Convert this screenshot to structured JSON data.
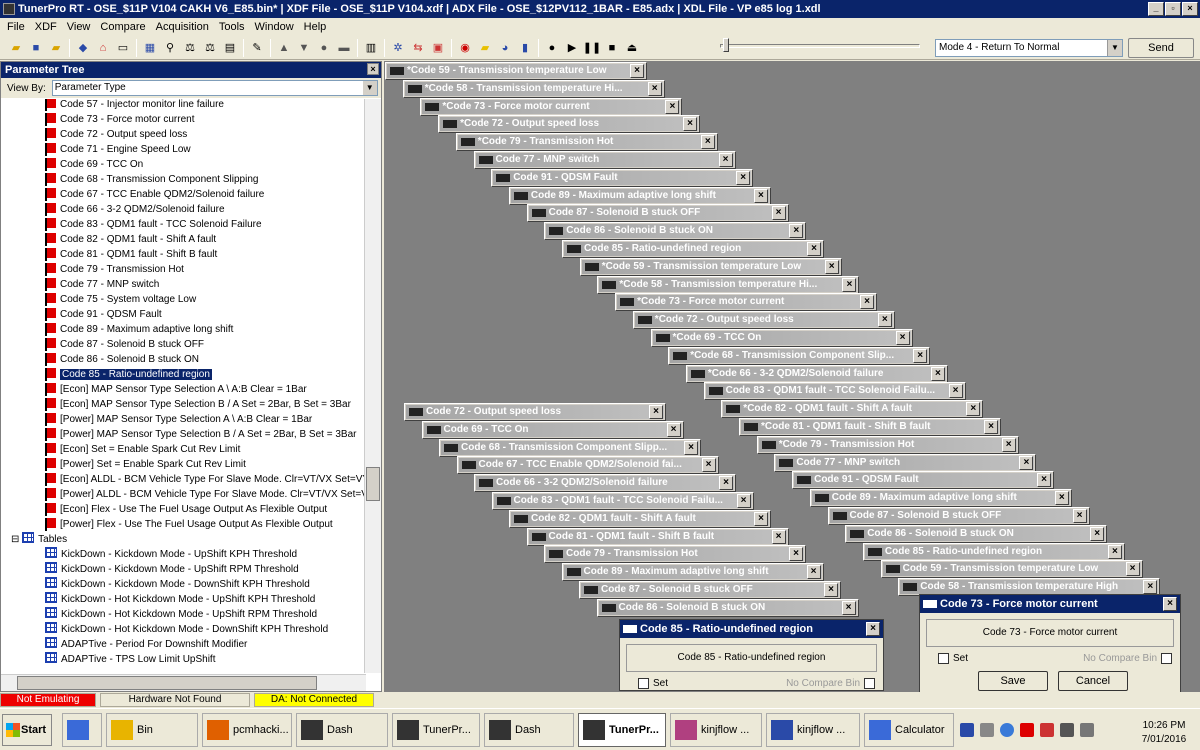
{
  "window": {
    "title": "TunerPro RT - OSE_$11P V104 CAKH V6_E85.bin* | XDF File - OSE_$11P V104.xdf | ADX File - OSE_$12PV112_1BAR - E85.adx | XDL File - VP e85 log 1.xdl"
  },
  "menu": [
    "File",
    "XDF",
    "View",
    "Compare",
    "Acquisition",
    "Tools",
    "Window",
    "Help"
  ],
  "toolbar": {
    "mode": "Mode 4 - Return To Normal",
    "send": "Send"
  },
  "paramtree": {
    "title": "Parameter Tree",
    "viewby_label": "View By:",
    "viewby_value": "Parameter Type",
    "codes": [
      "Code 57 - Injector monitor line failure",
      "Code 73 - Force motor current",
      "Code 72 - Output speed loss",
      "Code 71 - Engine Speed Low",
      "Code 69 - TCC On",
      "Code 68 - Transmission Component Slipping",
      "Code 67 - TCC Enable QDM2/Solenoid failure",
      "Code 66 - 3-2 QDM2/Solenoid failure",
      "Code 83 - QDM1 fault - TCC Solenoid Failure",
      "Code 82 - QDM1 fault - Shift A fault",
      "Code 81 - QDM1 fault - Shift B fault",
      "Code 79 - Transmission Hot",
      "Code 77 - MNP switch",
      "Code 75 - System voltage Low",
      "Code 91 - QDSM Fault",
      "Code 89 - Maximum adaptive long shift",
      "Code 87 - Solenoid B stuck OFF",
      "Code 86 - Solenoid B stuck ON",
      "Code 85 - Ratio-undefined region",
      "[Econ] MAP Sensor Type Selection A \\ A:B Clear = 1Bar",
      "[Econ] MAP Sensor Type Selection B / A Set = 2Bar, B Set = 3Bar",
      "[Power] MAP Sensor Type Selection A \\ A:B Clear = 1Bar",
      "[Power] MAP Sensor Type Selection B / A Set = 2Bar, B Set = 3Bar",
      "[Econ] Set = Enable Spark Cut Rev Limit",
      "[Power] Set = Enable Spark Cut Rev Limit",
      "[Econ] ALDL - BCM Vehicle Type For Slave Mode. Clr=VT/VX  Set=VY",
      "[Power] ALDL - BCM Vehicle Type For Slave Mode. Clr=VT/VX  Set=VY",
      "[Econ] Flex - Use The Fuel Usage Output As Flexible Output",
      "[Power] Flex - Use The Fuel Usage Output As Flexible Output"
    ],
    "tables_label": "Tables",
    "tables": [
      "KickDown - Kickdown Mode - UpShift KPH Threshold",
      "KickDown - Kickdown Mode - UpShift RPM Threshold",
      "KickDown - Kickdown Mode - DownShift KPH Threshold",
      "KickDown - Hot Kickdown Mode - UpShift KPH Threshold",
      "KickDown - Hot Kickdown Mode - UpShift RPM Threshold",
      "KickDown - Hot Kickdown Mode - DownShift KPH Threshold",
      "ADAPTive - Period For Downshift Modifier",
      "ADAPTive - TPS Low Limit UpShift"
    ]
  },
  "cascade1": [
    "*Code 59 - Transmission temperature Low",
    "*Code 58 - Transmission temperature Hi...",
    "*Code 73 - Force motor current",
    "*Code 72 - Output speed loss",
    "*Code 79 - Transmission Hot",
    "Code 77 - MNP switch",
    "Code 91 - QDSM Fault",
    "Code 89 - Maximum adaptive long shift",
    "Code 87 - Solenoid B stuck OFF",
    "Code 86 - Solenoid B stuck ON",
    "Code 85 - Ratio-undefined region",
    "*Code 59 - Transmission temperature Low",
    "*Code 58 - Transmission temperature Hi...",
    "*Code 73 - Force motor current",
    "*Code 72 - Output speed loss",
    "*Code 69 - TCC On",
    "*Code 68 - Transmission Component Slip...",
    "*Code 66 - 3-2 QDM2/Solenoid failure",
    "Code 83 - QDM1 fault - TCC Solenoid Failu...",
    "*Code 82 - QDM1 fault - Shift A fault",
    "*Code 81 - QDM1 fault - Shift B fault",
    "*Code 79 - Transmission Hot",
    "Code 77 - MNP switch",
    "Code 91 - QDSM Fault",
    "Code 89 - Maximum adaptive long shift",
    "Code 87 - Solenoid B stuck OFF",
    "Code 86 - Solenoid B stuck ON",
    "Code 85 - Ratio-undefined region",
    "Code 59 - Transmission temperature Low",
    "Code 58 - Transmission temperature High"
  ],
  "cascade2": [
    "Code 72 - Output speed loss",
    "Code 69 - TCC On",
    "Code 68 - Transmission Component Slipp...",
    "Code 67 - TCC Enable QDM2/Solenoid fai...",
    "Code 66 - 3-2 QDM2/Solenoid failure",
    "Code 83 - QDM1 fault - TCC Solenoid Failu...",
    "Code 82 - QDM1 fault - Shift A fault",
    "Code 81 - QDM1 fault - Shift B fault",
    "Code 79 - Transmission Hot",
    "Code 89 - Maximum adaptive long shift",
    "Code 87 - Solenoid B stuck OFF",
    "Code 86 - Solenoid B stuck ON"
  ],
  "dialog1": {
    "title": "Code 85 - Ratio-undefined region",
    "text": "Code 85 - Ratio-undefined region",
    "set": "Set",
    "nocompare": "No Compare Bin"
  },
  "dialog2": {
    "title": "Code 73 - Force motor current",
    "text": "Code 73 - Force motor current",
    "set": "Set",
    "nocompare": "No Compare Bin",
    "save": "Save",
    "cancel": "Cancel"
  },
  "status": {
    "emulating": "Not Emulating",
    "hardware": "Hardware Not Found",
    "da": "DA: Not Connected"
  },
  "taskbar": {
    "start": "Start",
    "tasks": [
      "",
      "Bin",
      "pcmhacki...",
      "Dash",
      "TunerPr...",
      "Dash",
      "TunerPr...",
      "kinjflow ...",
      "kinjflow ...",
      "Calculator"
    ],
    "time": "10:26 PM",
    "date": "7/01/2016"
  }
}
